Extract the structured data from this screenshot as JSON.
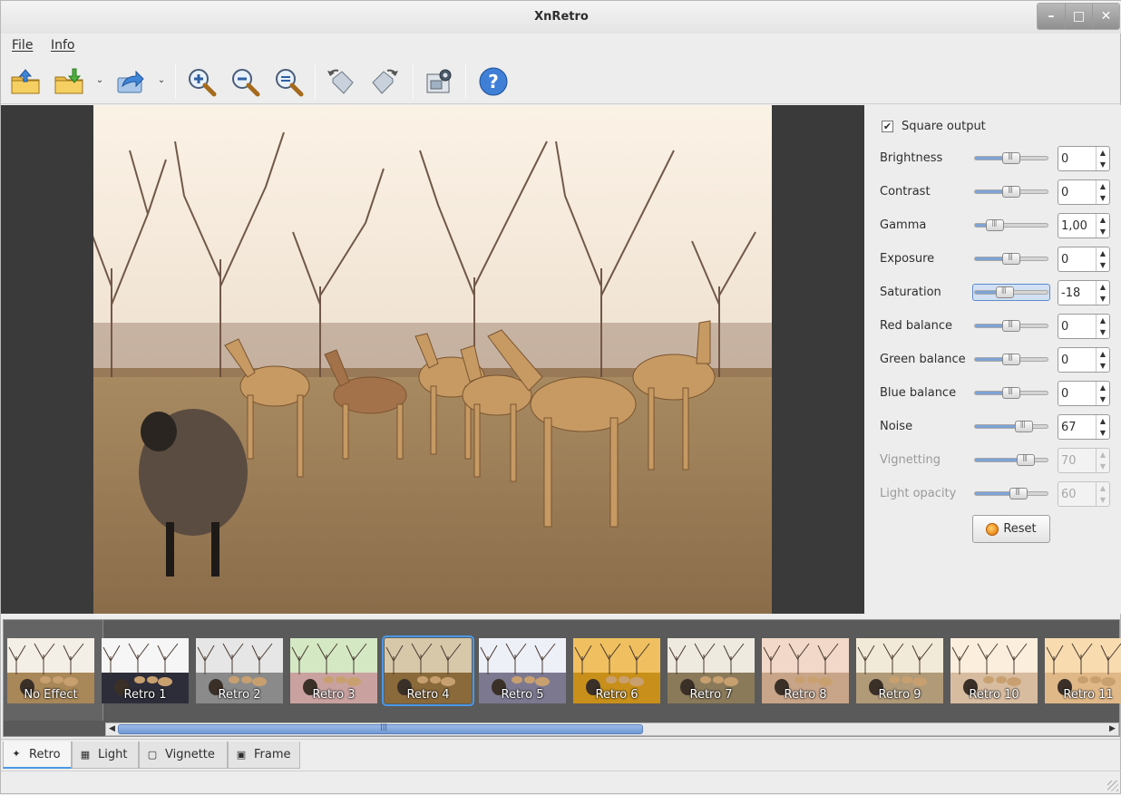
{
  "window": {
    "title": "XnRetro"
  },
  "menu": {
    "file": "File",
    "info": "Info"
  },
  "toolbar": {
    "icons": [
      "open-folder-icon",
      "save-icon",
      "share-icon",
      "zoom-in-icon",
      "zoom-out-icon",
      "zoom-fit-icon",
      "rotate-left-icon",
      "rotate-right-icon",
      "screenshot-icon",
      "help-icon"
    ]
  },
  "panel": {
    "square_output_label": "Square output",
    "square_output_checked": true,
    "reset_label": "Reset",
    "adjustments": [
      {
        "label": "Brightness",
        "value": "0",
        "level": 0.5,
        "enabled": true,
        "selected": false
      },
      {
        "label": "Contrast",
        "value": "0",
        "level": 0.5,
        "enabled": true,
        "selected": false
      },
      {
        "label": "Gamma",
        "value": "1,00",
        "level": 0.28,
        "enabled": true,
        "selected": false
      },
      {
        "label": "Exposure",
        "value": "0",
        "level": 0.5,
        "enabled": true,
        "selected": false
      },
      {
        "label": "Saturation",
        "value": "-18",
        "level": 0.41,
        "enabled": true,
        "selected": true
      },
      {
        "label": "Red balance",
        "value": "0",
        "level": 0.5,
        "enabled": true,
        "selected": false
      },
      {
        "label": "Green balance",
        "value": "0",
        "level": 0.5,
        "enabled": true,
        "selected": false
      },
      {
        "label": "Blue balance",
        "value": "0",
        "level": 0.5,
        "enabled": true,
        "selected": false
      },
      {
        "label": "Noise",
        "value": "67",
        "level": 0.67,
        "enabled": true,
        "selected": false
      },
      {
        "label": "Vignetting",
        "value": "70",
        "level": 0.7,
        "enabled": false,
        "selected": false
      },
      {
        "label": "Light opacity",
        "value": "60",
        "level": 0.6,
        "enabled": false,
        "selected": false
      }
    ]
  },
  "filmstrip": {
    "selected": "Retro 4",
    "items": [
      "No Effect",
      "Retro 1",
      "Retro 2",
      "Retro 3",
      "Retro 4",
      "Retro 5",
      "Retro 6",
      "Retro 7",
      "Retro 8",
      "Retro 9",
      "Retro 10",
      "Retro 11"
    ],
    "scroll_fraction": 0.53
  },
  "tabs": [
    "Retro",
    "Light",
    "Vignette",
    "Frame"
  ],
  "active_tab": "Retro"
}
